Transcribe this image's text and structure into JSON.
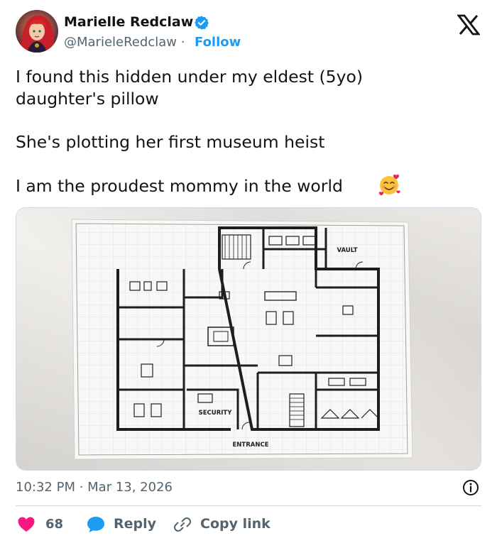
{
  "author": {
    "name": "Marielle Redclaw",
    "handle": "@MarieleRedclaw",
    "separator": "·",
    "follow_label": "Follow"
  },
  "tweet": {
    "lines": [
      "I found this hidden under my eldest (5yo)",
      "daughter's pillow",
      "She's plotting her first museum heist",
      "I am the proudest mommy in the world"
    ],
    "emoji": "smiling-face-with-hearts"
  },
  "floorplan_labels": {
    "vault": "VAULT",
    "security": "SECURITY",
    "entrance": "ENTRANCE"
  },
  "meta": {
    "timestamp": "10:32 PM · Mar 13, 2026"
  },
  "actions": {
    "likes": "68",
    "reply_label": "Reply",
    "copy_label": "Copy link"
  },
  "colors": {
    "accent": "#1d9bf0",
    "heart": "#f91880",
    "muted": "#536471",
    "text": "#0f1419"
  },
  "icons": [
    "verified-icon",
    "x-logo-icon",
    "info-icon",
    "heart-icon",
    "reply-icon",
    "link-icon"
  ]
}
